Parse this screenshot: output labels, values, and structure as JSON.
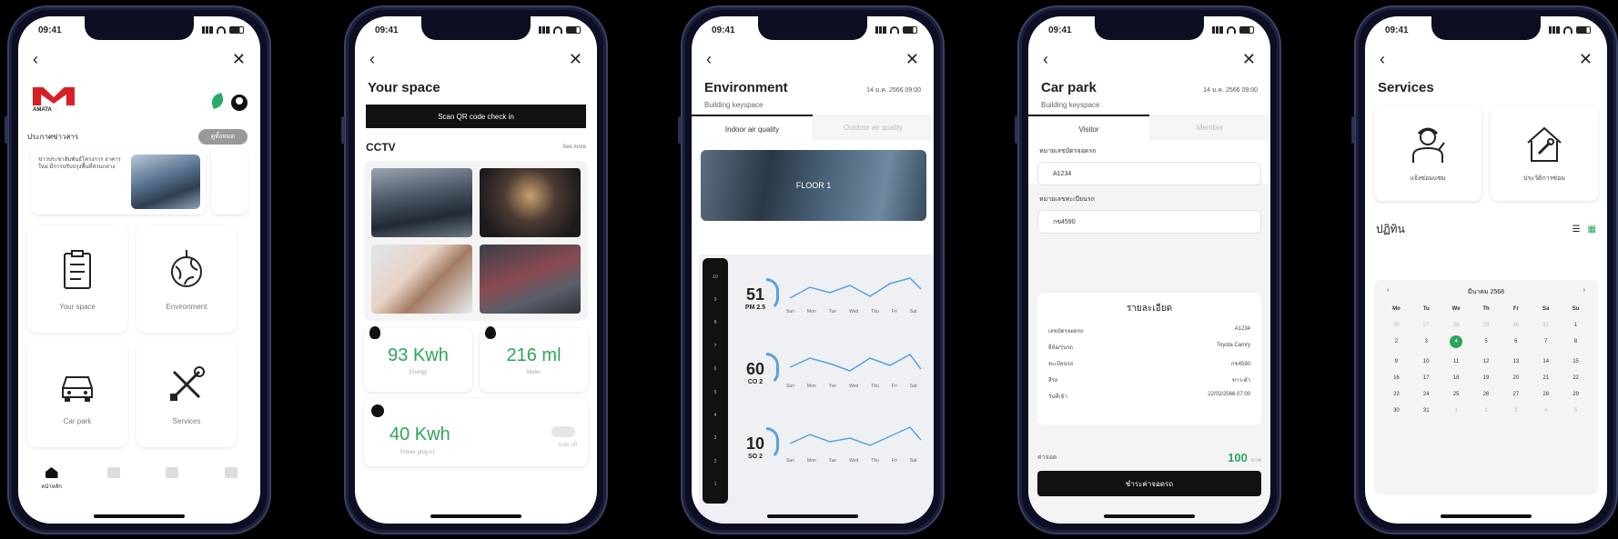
{
  "status_time": "09:41",
  "phone1": {
    "news_label": "ประกาศข่าวสาร",
    "see_all": "ดูทั้งหมด",
    "news_text": "ข่าวประชาสัมพันธ์โครงการ อาคาร ใหม่ มีการปรับปรุงพื้นที่ส่วนกลาง",
    "tiles": [
      "Your space",
      "Environment",
      "Car park",
      "Services"
    ],
    "tabs": [
      "หน้าหลัก",
      "",
      "",
      ""
    ],
    "brand": "AMATA"
  },
  "phone2": {
    "title": "Your space",
    "scan": "Scan QR code check in",
    "cctv": "CCTV",
    "see_all": "See more",
    "energy_value": "93 Kwh",
    "energy_label": "Energy",
    "water_value": "216 ml",
    "water_label": "Water",
    "power_value": "40 Kwh",
    "power_label": "Power plug #1",
    "toggle_label": "Auto off"
  },
  "phone3": {
    "title": "Environment",
    "date": "14 ม.ค. 2566  09:00",
    "subtitle": "Building keyspace",
    "tab_on": "Indoor air quality",
    "tab_off": "Outdoor air quality",
    "floor": "FLOOR 1",
    "metrics": [
      {
        "value": "51",
        "name": "PM 2.5"
      },
      {
        "value": "60",
        "name": "CO 2"
      },
      {
        "value": "10",
        "name": "SO 2"
      }
    ],
    "days": [
      "Sun",
      "Mon",
      "Tue",
      "Wed",
      "Thu",
      "Fri",
      "Sat"
    ]
  },
  "phone4": {
    "title": "Car park",
    "date": "14 ม.ค. 2566  09:00",
    "subtitle": "Building keyspace",
    "tab_on": "Visitor",
    "tab_off": "Member",
    "label1": "หมายเลขบัตรจอดรถ",
    "value1": "A1234",
    "label2": "หมายเลขทะเบียนรถ",
    "value2": "กข4590",
    "summary_title": "รายละเอียด",
    "rows": [
      {
        "k": "เลขบัตรจอดรถ",
        "v": "A1234"
      },
      {
        "k": "ยี่ห้อ/รุ่นรถ",
        "v": "Toyota Camry"
      },
      {
        "k": "ทะเบียนรถ",
        "v": "กข4590"
      },
      {
        "k": "สีรถ",
        "v": "ขาว-ดำ"
      },
      {
        "k": "วันที่เข้า",
        "v": "22/02/2566 07:00"
      }
    ],
    "fee_label": "ค่าจอด",
    "fee_value": "100",
    "fee_unit": "บาท",
    "submit": "ชำระค่าจอดรถ"
  },
  "phone5": {
    "title": "Services",
    "svc": [
      "แจ้งซ่อมแซม",
      "ประวัติการซ่อม"
    ],
    "cal_title": "ปฏิทิน",
    "month": "มีนาคม 2568",
    "dow": [
      "Mo",
      "Tu",
      "We",
      "Th",
      "Fr",
      "Sa",
      "Su"
    ],
    "weeks": [
      [
        "26",
        "27",
        "28",
        "29",
        "30",
        "31",
        "1"
      ],
      [
        "2",
        "3",
        "4",
        "5",
        "6",
        "7",
        "8"
      ],
      [
        "9",
        "10",
        "11",
        "12",
        "13",
        "14",
        "15"
      ],
      [
        "16",
        "17",
        "18",
        "19",
        "20",
        "21",
        "22"
      ],
      [
        "23",
        "24",
        "25",
        "26",
        "27",
        "28",
        "29"
      ],
      [
        "30",
        "31",
        "1",
        "2",
        "3",
        "4",
        "5"
      ]
    ],
    "selected": "4"
  }
}
